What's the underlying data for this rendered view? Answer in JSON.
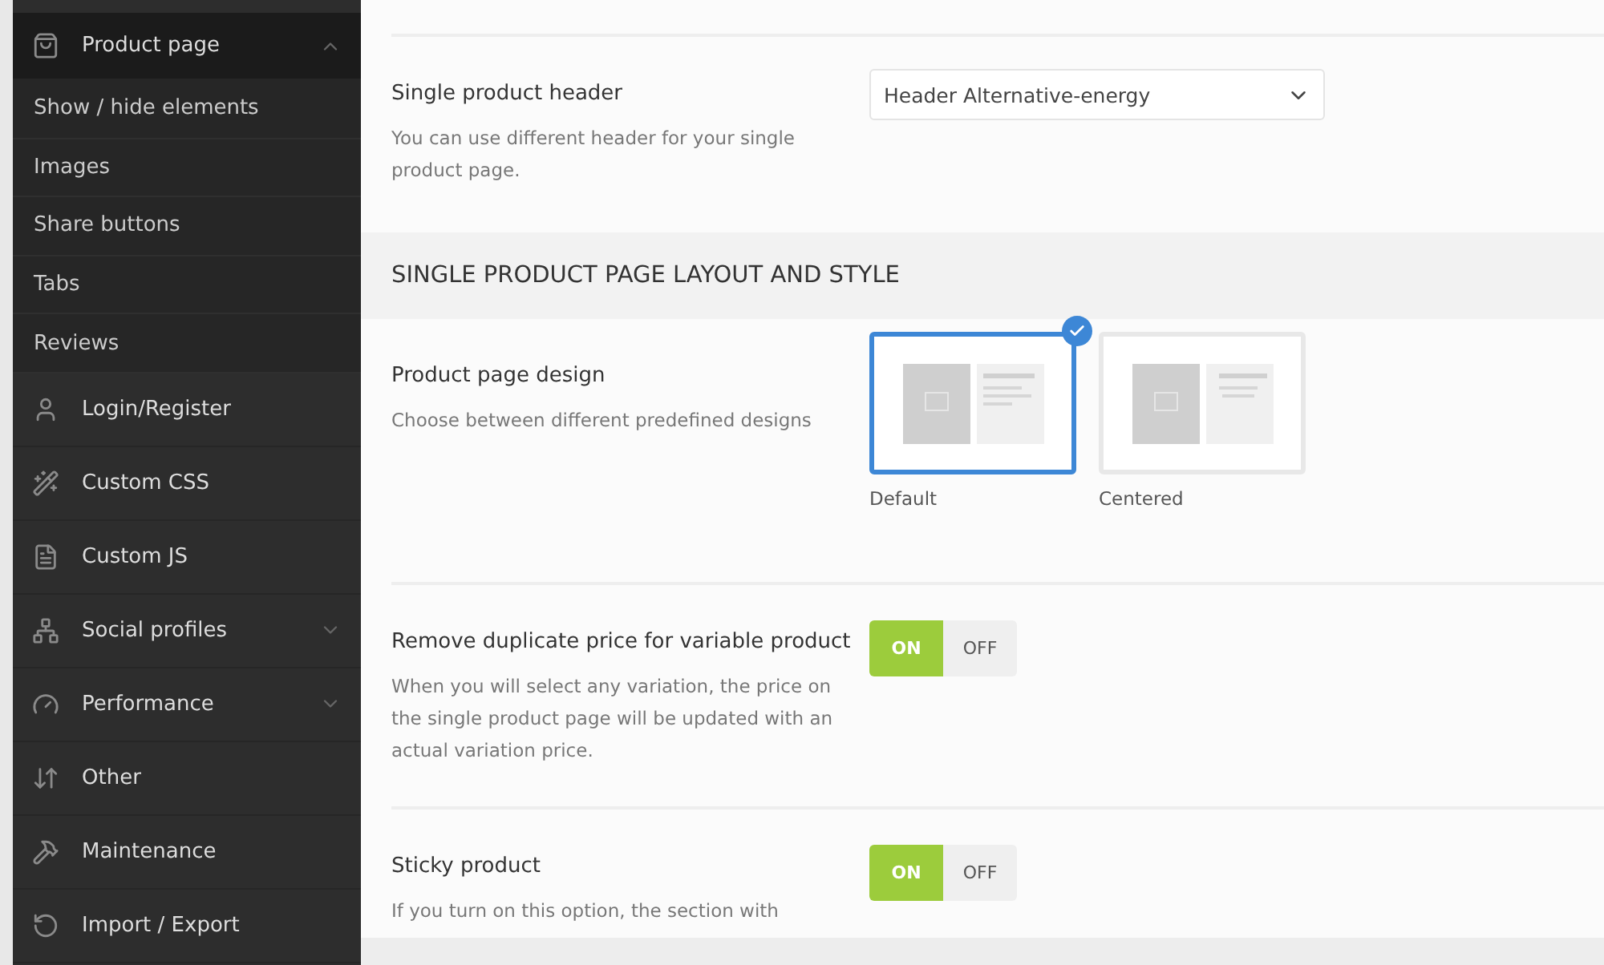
{
  "sidebar": {
    "items": [
      {
        "kind": "main",
        "label": "Product page",
        "expanded": true,
        "children": [
          {
            "label": "Show / hide elements"
          },
          {
            "label": "Images"
          },
          {
            "label": "Share buttons"
          },
          {
            "label": "Tabs"
          },
          {
            "label": "Reviews"
          }
        ]
      },
      {
        "kind": "main",
        "label": "Login/Register"
      },
      {
        "kind": "main",
        "label": "Custom CSS"
      },
      {
        "kind": "main",
        "label": "Custom JS"
      },
      {
        "kind": "main",
        "label": "Social profiles",
        "expanded": false
      },
      {
        "kind": "main",
        "label": "Performance",
        "expanded": false
      },
      {
        "kind": "main",
        "label": "Other"
      },
      {
        "kind": "main",
        "label": "Maintenance"
      },
      {
        "kind": "main",
        "label": "Import / Export"
      }
    ]
  },
  "content": {
    "blocks": [
      {
        "kind": "select",
        "title": "Single product header",
        "description": "You can use different header for your single product page.",
        "value": "Header Alternative-energy"
      },
      {
        "kind": "heading",
        "title": "SINGLE PRODUCT PAGE LAYOUT AND STYLE"
      },
      {
        "kind": "designs",
        "title": "Product page design",
        "description": "Choose between different predefined designs",
        "options": [
          {
            "label": "Default",
            "selected": true
          },
          {
            "label": "Centered",
            "selected": false
          }
        ]
      },
      {
        "kind": "toggle",
        "title": "Remove duplicate price for variable product",
        "description": "When you will select any variation, the price on the single product page will be updated with an actual variation price.",
        "on": true,
        "on_label": "ON",
        "off_label": "OFF"
      },
      {
        "kind": "toggle",
        "title": "Sticky product",
        "description": "If you turn on this option, the section with",
        "on": true,
        "on_label": "ON",
        "off_label": "OFF"
      }
    ]
  }
}
